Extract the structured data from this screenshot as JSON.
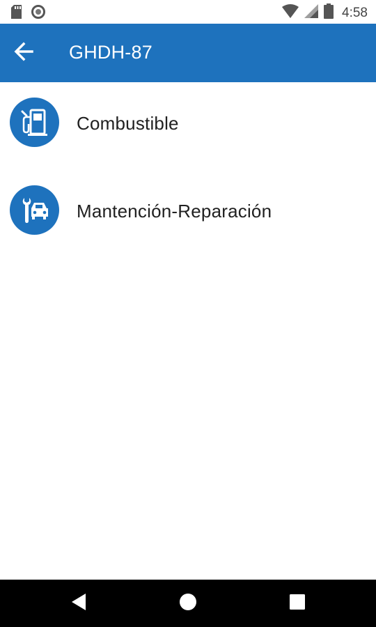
{
  "status_bar": {
    "time": "4:58",
    "icons": [
      "sd-card-icon",
      "sync-circle-icon",
      "wifi-icon",
      "cell-signal-icon",
      "battery-icon"
    ]
  },
  "app_bar": {
    "title": "GHDH-87",
    "back_icon": "arrow-back-icon",
    "color": "#1e72bd"
  },
  "menu": {
    "items": [
      {
        "label": "Combustible",
        "icon": "fuel-pump-icon"
      },
      {
        "label": "Mantención-Reparación",
        "icon": "car-repair-icon"
      }
    ]
  },
  "nav_bar": {
    "icons": [
      "back-triangle-icon",
      "home-circle-icon",
      "recents-square-icon"
    ]
  }
}
